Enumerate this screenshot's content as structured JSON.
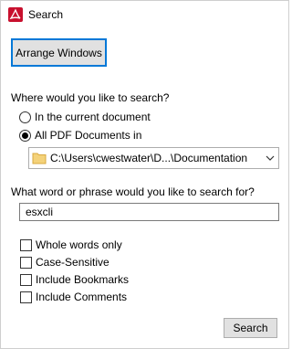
{
  "window": {
    "title": "Search",
    "icon": "acrobat-pdf-icon"
  },
  "buttons": {
    "arrange_windows": "Arrange Windows",
    "search": "Search"
  },
  "where": {
    "question": "Where would you like to search?",
    "options": [
      {
        "label": "In the current document",
        "checked": false
      },
      {
        "label": "All PDF Documents in",
        "checked": true
      }
    ],
    "location": {
      "value": "C:\\Users\\cwestwater\\D...\\Documentation",
      "icon": "folder-icon"
    }
  },
  "what": {
    "question": "What word or phrase would you like to search for?",
    "value": "esxcli"
  },
  "options": [
    {
      "label": "Whole words only",
      "checked": false
    },
    {
      "label": "Case-Sensitive",
      "checked": false
    },
    {
      "label": "Include Bookmarks",
      "checked": false
    },
    {
      "label": "Include Comments",
      "checked": false
    }
  ],
  "colors": {
    "accent": "#0078d7",
    "pdf_red": "#c8102e",
    "folder_yellow": "#f4d27a"
  }
}
